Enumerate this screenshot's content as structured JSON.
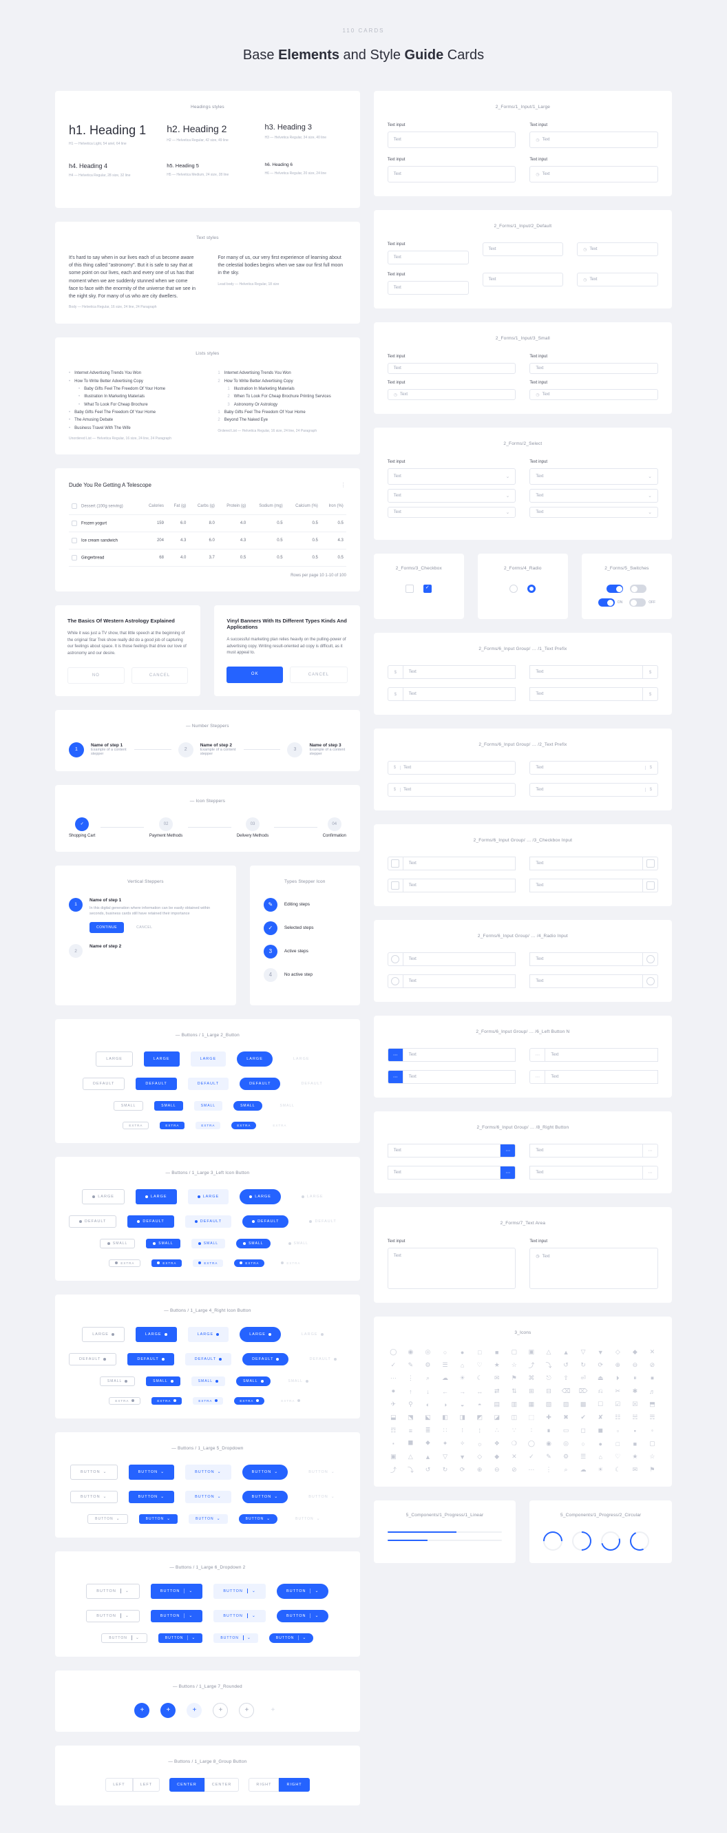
{
  "top_label": "110 CARDS",
  "title_parts": [
    "Base ",
    "Elements",
    " and Style ",
    "Guide",
    " Cards"
  ],
  "headings": {
    "card_title": "Headings styles",
    "h1": "h1. Heading 1",
    "h1_meta": "H1 — Helvetica Light, 54 ariel, 64 line",
    "h2": "h2. Heading 2",
    "h2_meta": "H2 — Helvetica Regular, 42 size, 49 line",
    "h3": "h3. Heading 3",
    "h3_meta": "H3 — Helvetica Regular, 34 size, 40 line",
    "h4": "h4. Heading 4",
    "h4_meta": "H4 — Helvetica Regular, 28 size, 32 line",
    "h5": "h5. Heading 5",
    "h5_meta": "H5 — Helvetica Medium, 24 size, 28 line",
    "h6": "h6. Heading 6",
    "h6_meta": "H6 — Helvetica Regular, 20 size, 24 line"
  },
  "text": {
    "card_title": "Text styles",
    "p1": "It's hard to say when in our lives each of us become aware of this thing called \"astronomy\". But it is safe to say that at some point on our lives, each and every one of us has that moment when we are suddenly stunned when we come face to face with the enormity of the universe that we see in the night sky. For many of us who are city dwellers.",
    "p1_meta": "Body — Helvetica Regular, 16 size, 24 line, 24 Paragraph",
    "p2": "For many of us, our very first experience of learning about the celestial bodies begins when we saw our first full moon in the sky.",
    "p2_meta": "Lead body — Helvetica Regular, 18 size"
  },
  "lists": {
    "card_title": "Lists styles",
    "ul": [
      "Internet Advertising Trends You Won",
      "How To Write Better Advertising Copy"
    ],
    "ul_nested": [
      "Baby Gifts Feel The Freedom Of Your Home",
      "Illustration In Marketing Materials",
      "What To Look For Cheap Brochure"
    ],
    "ul2": [
      "Baby Gifts Feel The Freedom Of Your Home",
      "The Amusing Debate",
      "Business Travel With The Wife"
    ],
    "ul_meta": "Unordered List — Helvetica Regular, 16 size, 24 line, 24 Paragraph",
    "ol": [
      "Internet Advertising Trends You Won",
      "How To Write Better Advertising Copy"
    ],
    "ol_nested": [
      "Illustration In Marketing Materials",
      "When To Look For Cheap Brochure Printing Services",
      "Astronomy Or Astrology"
    ],
    "ol2": [
      "Baby Gifts Feel The Freedom Of Your Home",
      "Beyond The Naked Eye"
    ],
    "ol_meta": "Ordered List — Helvetica Regular, 16 size, 24 line, 24 Paragraph"
  },
  "table": {
    "title": "Dude You Re Getting A Telescope",
    "cols": [
      "Dessert (100g serving)",
      "Calories",
      "Fat (g)",
      "Carbs (g)",
      "Protein (g)",
      "Sodium (mg)",
      "Calcium (%)",
      "Iron (%)"
    ],
    "rows": [
      [
        "Frozen yogurt",
        "159",
        "6.0",
        "8.0",
        "4.0",
        "0.5",
        "0.5",
        "0.5"
      ],
      [
        "Ice cream sandwich",
        "204",
        "4.3",
        "6.0",
        "4.3",
        "0.5",
        "0.5",
        "4.3"
      ],
      [
        "Gingerbread",
        "68",
        "4.0",
        "3.7",
        "0.5",
        "0.5",
        "0.5",
        "0.5"
      ]
    ],
    "pager": "Rows per page   10   1-10 of 100"
  },
  "modals": {
    "m1": {
      "title": "The Basics Of Western Astrology Explained",
      "body": "While it was just a TV show, that little speech at the beginning of the original Star Trek show really did do a good job of capturing our feelings about space. It is those feelings that drive our love of astronomy and our desire.",
      "no": "NO",
      "cancel": "CANCEL"
    },
    "m2": {
      "title": "Vinyl Banners With Its Different Types Kinds And Applications",
      "body": "A successful marketing plan relies heavily on the pulling-power of advertising copy. Writing result-oriented ad copy is difficult, as it must appeal to.",
      "ok": "OK",
      "cancel": "CANCEL"
    }
  },
  "stepper_num": {
    "card_title": "— Number Steppers",
    "s1": "Name of step 1",
    "d1": "Example of a content stepper",
    "s2": "Name of step 2",
    "d2": "Example of a content stepper",
    "s3": "Name of step 3",
    "d3": "Example of a content stepper"
  },
  "stepper_icon": {
    "card_title": "— Icon Steppers",
    "l1": "Shopping Cart",
    "l2": "Payment Methods",
    "l3": "Delivery Methods",
    "l4": "Confirmation"
  },
  "stepper_vert": {
    "card_title": "Vertical Steppers",
    "s1": "Name of step 1",
    "d1": "In this digital generation where information can be easily obtained within seconds, business cards still have retained their importance",
    "continue": "CONTINUE",
    "cancel": "CANCEL",
    "s2": "Name of step 2"
  },
  "stepper_types": {
    "card_title": "Types Stepper Icon",
    "t1": "Editing steps",
    "t2": "Selected steps",
    "t3": "Active steps",
    "t4": "No active step"
  },
  "buttons": {
    "l": "LARGE",
    "d": "DEFAULT",
    "s": "SMALL",
    "x": "EXTRA",
    "b": "BUTTON"
  },
  "btncards": {
    "c1": "— Buttons / 1_Large 2_Button",
    "c2": "— Buttons / 1_Large 3_Left Icon Button",
    "c3": "— Buttons / 1_Large 4_Right Icon Button",
    "c4": "— Buttons / 1_Large 5_Dropdown",
    "c5": "— Buttons / 1_Large 6_Dropdown 2",
    "c6": "— Buttons / 1_Large 7_Rounded",
    "c7": "— Buttons / 1_Large 8_Group Button"
  },
  "groups": {
    "l": "LEFT",
    "c": "CENTER",
    "r": "RIGHT"
  },
  "inputs": {
    "lg": "2_Forms/1_Input/1_Large",
    "md": "2_Forms/1_Input/2_Default",
    "sm": "2_Forms/1_Input/3_Small",
    "label": "Text input",
    "ph": "Text"
  },
  "select": {
    "card": "2_Forms/2_Select",
    "label": "Text input",
    "ph": "Text"
  },
  "check": {
    "card": "2_Forms/3_Checkbox"
  },
  "radio": {
    "card": "2_Forms/4_Radio"
  },
  "switch": {
    "card": "2_Forms/5_Switches",
    "on": "ON",
    "off": "OFF"
  },
  "ig": {
    "c1": "2_Forms/6_Input Group/ … /1_Text Prefix",
    "c2": "2_Forms/6_Input Group/ … /2_Text Prefix",
    "c3": "2_Forms/6_Input Group/ … /3_Checkbox Input",
    "c4": "2_Forms/6_Input Group/ … /4_Radio Input",
    "c5": "2_Forms/6_Input Group/ … /6_Left Button N",
    "c6": "2_Forms/6_Input Group/ … /8_Right Button",
    "ph": "Text"
  },
  "ta": {
    "card": "2_Forms/7_Text Area",
    "label": "Text input",
    "ph": "Text"
  },
  "icons": {
    "card": "3_Icons"
  },
  "progress": {
    "c1": "5_Components/1_Progress/1_Linear",
    "c2": "5_Components/1_Progress/2_Circular"
  }
}
